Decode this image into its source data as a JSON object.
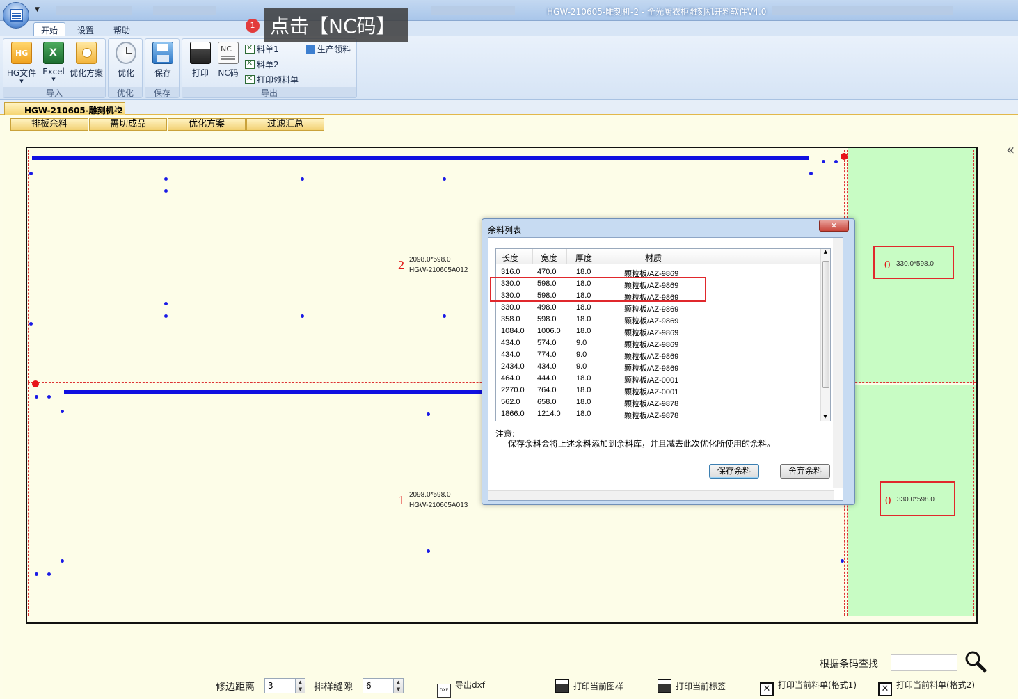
{
  "window": {
    "title": "HGW-210605-雕刻机-2 - 全光厨衣柜雕刻机开料软件V4.0"
  },
  "ribbon_tabs": [
    "开始",
    "设置",
    "帮助"
  ],
  "callout": {
    "badge": "1",
    "text": "点击【NC码】"
  },
  "groups": {
    "import": {
      "label": "导入",
      "hg_file": "HG文件",
      "hg_icon_text": "HG",
      "excel": "Excel",
      "excel_icon_text": "X",
      "opt_plan": "优化方案"
    },
    "optimize": {
      "label": "优化",
      "button": "优化"
    },
    "save": {
      "label": "保存",
      "button": "保存"
    },
    "export": {
      "label": "导出",
      "print": "打印",
      "nc": "NC码",
      "nc_icon_text": "NC",
      "list1": "料单1",
      "list2": "料单2",
      "print_pick": "打印领料单",
      "prod_pick": "生产领料"
    }
  },
  "doc_tab": {
    "label": "HGW-210605-雕刻机-2",
    "close": "×"
  },
  "sub_tabs": [
    "排板余料",
    "需切成品",
    "优化方案",
    "过滤汇总"
  ],
  "sheet": {
    "parts": [
      {
        "no": "2",
        "size": "2098.0*598.0",
        "code": "HGW-210605A012"
      },
      {
        "no": "1",
        "size": "2098.0*598.0",
        "code": "HGW-210605A013"
      }
    ],
    "remnants": [
      {
        "no": "0",
        "size": "330.0*598.0"
      },
      {
        "no": "0",
        "size": "330.0*598.0"
      }
    ]
  },
  "dialog": {
    "title": "余料列表",
    "close": "✕",
    "columns": [
      "长度",
      "宽度",
      "厚度",
      "材质"
    ],
    "rows": [
      [
        "316.0",
        "470.0",
        "18.0",
        "颗粒板/AZ-9869"
      ],
      [
        "330.0",
        "598.0",
        "18.0",
        "颗粒板/AZ-9869"
      ],
      [
        "330.0",
        "598.0",
        "18.0",
        "颗粒板/AZ-9869"
      ],
      [
        "330.0",
        "498.0",
        "18.0",
        "颗粒板/AZ-9869"
      ],
      [
        "358.0",
        "598.0",
        "18.0",
        "颗粒板/AZ-9869"
      ],
      [
        "1084.0",
        "1006.0",
        "18.0",
        "颗粒板/AZ-9869"
      ],
      [
        "434.0",
        "574.0",
        "9.0",
        "颗粒板/AZ-9869"
      ],
      [
        "434.0",
        "774.0",
        "9.0",
        "颗粒板/AZ-9869"
      ],
      [
        "2434.0",
        "434.0",
        "9.0",
        "颗粒板/AZ-9869"
      ],
      [
        "464.0",
        "444.0",
        "18.0",
        "颗粒板/AZ-0001"
      ],
      [
        "2270.0",
        "764.0",
        "18.0",
        "颗粒板/AZ-0001"
      ],
      [
        "562.0",
        "658.0",
        "18.0",
        "颗粒板/AZ-9878"
      ],
      [
        "1866.0",
        "1214.0",
        "18.0",
        "颗粒板/AZ-9878"
      ]
    ],
    "note_title": "注意:",
    "note_text": "保存余料会将上述余料添加到余料库，并且减去此次优化所使用的余料。",
    "save_btn": "保存余料",
    "discard_btn": "舍弃余料"
  },
  "bottom": {
    "trim_label": "修边距离",
    "trim_value": "3",
    "gap_label": "排样缝隙",
    "gap_value": "6",
    "export_dxf": "导出dxf",
    "dxf_icon_text": "DXF",
    "print_pattern": "打印当前图样",
    "print_label": "打印当前标签",
    "print_list1": "打印当前料单(格式1)",
    "print_list2": "打印当前料单(格式2)",
    "barcode_label": "根据条码查找",
    "barcode_value": ""
  },
  "colors": {
    "accent_blue": "#1010e0",
    "remnant_green": "#c8fcc4",
    "highlight_red": "#e0282c"
  }
}
